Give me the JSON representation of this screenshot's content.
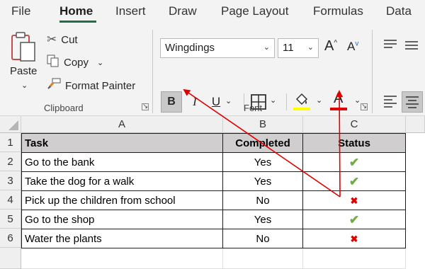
{
  "tabs": [
    {
      "label": "File"
    },
    {
      "label": "Home"
    },
    {
      "label": "Insert"
    },
    {
      "label": "Draw"
    },
    {
      "label": "Page Layout"
    },
    {
      "label": "Formulas"
    },
    {
      "label": "Data"
    }
  ],
  "clipboard": {
    "paste_label": "Paste",
    "cut_label": "Cut",
    "copy_label": "Copy",
    "format_painter_label": "Format Painter",
    "group_label": "Clipboard"
  },
  "font": {
    "font_name": "Wingdings",
    "font_size": "11",
    "group_label": "Font",
    "bold": "B",
    "italic": "I",
    "underline": "U",
    "font_color_letter": "A",
    "highlight_color": "#ffff00",
    "font_color": "#e00000"
  },
  "columns": [
    "A",
    "B",
    "C"
  ],
  "rows": [
    "1",
    "2",
    "3",
    "4",
    "5",
    "6"
  ],
  "table": {
    "headers": [
      "Task",
      "Completed",
      "Status"
    ],
    "rows": [
      {
        "task": "Go to the bank",
        "completed": "Yes",
        "status": "check"
      },
      {
        "task": "Take the dog for a walk",
        "completed": "Yes",
        "status": "check"
      },
      {
        "task": "Pick up the children from school",
        "completed": "No",
        "status": "cross"
      },
      {
        "task": "Go to the shop",
        "completed": "Yes",
        "status": "check"
      },
      {
        "task": "Water the plants",
        "completed": "No",
        "status": "cross"
      }
    ]
  },
  "colors": {
    "accent": "#1f7145",
    "check": "#70ad47",
    "cross": "#e00000",
    "arrow": "#e00000"
  }
}
